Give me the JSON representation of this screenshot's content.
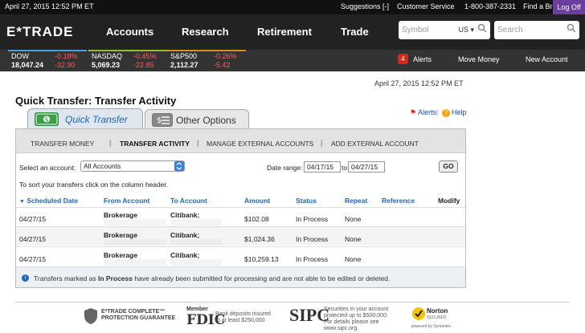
{
  "topbar": {
    "date": "April 27, 2015 12:52 PM ET",
    "suggestions": "Suggestions [-]",
    "customer_service": "Customer Service",
    "phone": "1-800-387-2331",
    "find_branch": "Find a Branch",
    "log_off": "Log Off"
  },
  "nav": {
    "logo": "E*TRADE",
    "items": [
      "Accounts",
      "Research",
      "Retirement",
      "Trade"
    ],
    "symbol_placeholder": "Symbol",
    "symbol_market": "US",
    "search_placeholder": "Search"
  },
  "tickers": [
    {
      "name": "DOW",
      "pct": "-0.18%",
      "value": "18,047.24",
      "change": "-32.90",
      "color": "#4a9fe0"
    },
    {
      "name": "NASDAQ",
      "pct": "-0.45%",
      "value": "5,069.23",
      "change": "-22.85",
      "color": "#8fbf3f"
    },
    {
      "name": "S&P500",
      "pct": "-0.26%",
      "value": "2,112.27",
      "change": "-5.42",
      "color": "#d98a2b"
    }
  ],
  "util": {
    "alerts_count": "4",
    "alerts": "Alerts",
    "move_money": "Move Money",
    "new_account": "New Account"
  },
  "page": {
    "datetime": "April 27, 2015 12:52 PM ET",
    "title": "Quick Transfer: Transfer Activity",
    "alerts_link": "Alerts",
    "help_link": "Help"
  },
  "tabs": {
    "quick_transfer": "Quick Transfer",
    "other_options": "Other Options"
  },
  "subnav": {
    "transfer_money": "TRANSFER MONEY",
    "transfer_activity": "TRANSFER ACTIVITY",
    "manage_external": "MANAGE EXTERNAL ACCOUNTS",
    "add_external": "ADD EXTERNAL ACCOUNT",
    "separator": "|"
  },
  "filters": {
    "account_label": "Select an account:",
    "account_value": "All Accounts",
    "date_label": "Date range:",
    "date_from": "04/17/15",
    "to": "to",
    "date_to": "04/27/15",
    "go": "GO",
    "sort_hint": "To sort your transfers click on the column header."
  },
  "table": {
    "headers": [
      "Scheduled Date",
      "From Account",
      "To Account",
      "Amount",
      "Status",
      "Repeat",
      "Reference",
      "Modify"
    ],
    "rows": [
      {
        "date": "04/27/15",
        "from": "Brokerage",
        "to": "Citibank;",
        "amount": "$102.08",
        "status": "In Process",
        "repeat": "None"
      },
      {
        "date": "04/27/15",
        "from": "Brokerage",
        "to": "Citibank;",
        "amount": "$1,024.36",
        "status": "In Process",
        "repeat": "None"
      },
      {
        "date": "04/27/15",
        "from": "Brokerage",
        "to": "Citibank;",
        "amount": "$10,259.13",
        "status": "In Process",
        "repeat": "None"
      }
    ]
  },
  "note": {
    "pre": "Transfers marked as ",
    "bold": "In Process",
    "post": " have already been submitted for processing and are not able to be edited or deleted."
  },
  "footer": {
    "etrade_guarantee": [
      "E*TRADE COMPLETE™",
      "PROTECTION GUARANTEE"
    ],
    "member": "Member",
    "fdic": "FDIC",
    "fdic_text": [
      "Bank deposits insured",
      "to at least $250,000"
    ],
    "sipc": "SIPC",
    "sipc_text": [
      "Securities in your account",
      "protected up to $500,000.",
      "For details please see",
      "www.sipc.org."
    ],
    "norton": [
      "Norton",
      "SECURED"
    ],
    "norton_by": "powered by Symantec"
  }
}
